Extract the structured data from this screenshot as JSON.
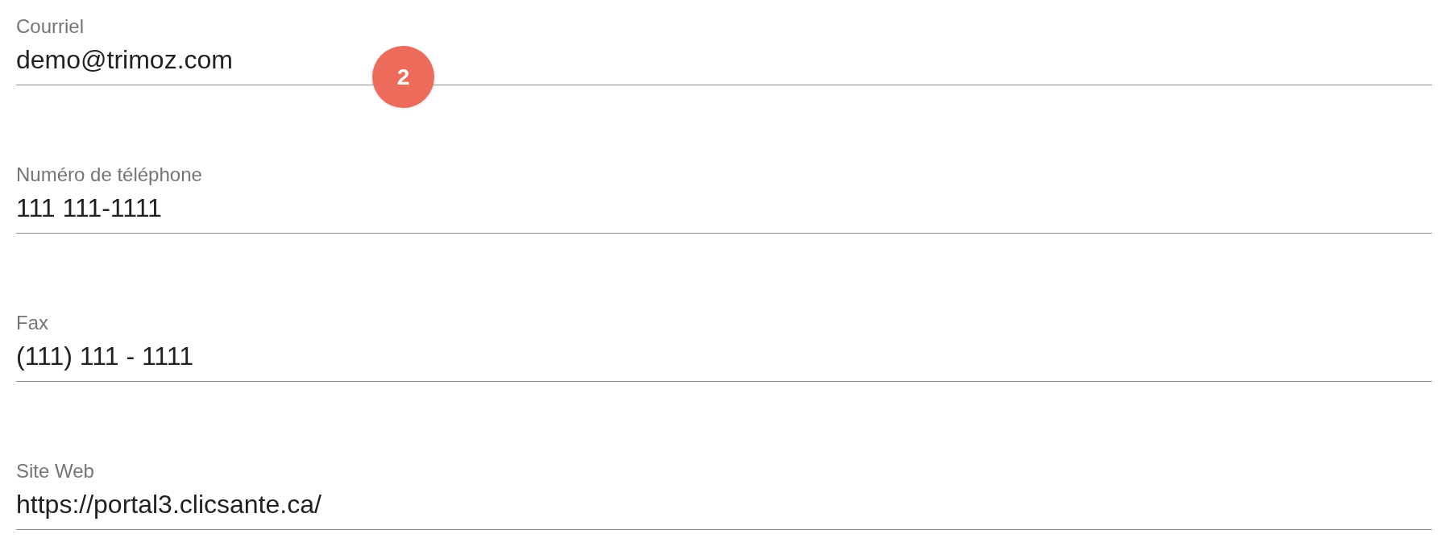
{
  "fields": [
    {
      "label": "Courriel",
      "value": "demo@trimoz.com"
    },
    {
      "label": "Numéro de téléphone",
      "value": "111 111-1111"
    },
    {
      "label": "Fax",
      "value": "(111) 111 - 1111"
    },
    {
      "label": "Site Web",
      "value": "https://portal3.clicsante.ca/"
    }
  ],
  "step_marker": {
    "text": "2"
  }
}
